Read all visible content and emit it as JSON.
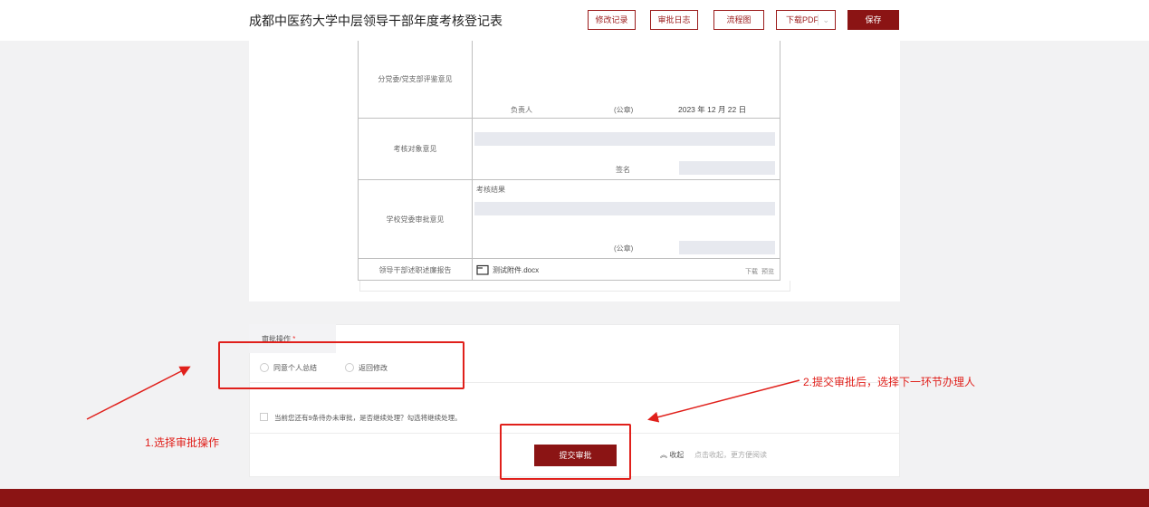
{
  "header": {
    "title": "成都中医药大学中层领导干部年度考核登记表",
    "buttons": {
      "history": "修改记录",
      "approval_log": "审批日志",
      "flowchart": "流程图",
      "download": "下载PDF",
      "save": "保存"
    }
  },
  "form": {
    "branch_opinion": {
      "label": "分党委/党支部评鉴意见",
      "responsible": "负责人",
      "seal": "(公章)",
      "date": "2023 年 12 月 22 日"
    },
    "subject_opinion": {
      "label": "考核对象意见",
      "sign": "签名"
    },
    "school_opinion": {
      "label": "学校党委审批意见",
      "result": "考核结果",
      "seal": "(公章)"
    },
    "report": {
      "label": "领导干部述职述廉报告",
      "file_name": "测试附件.docx",
      "download": "下载",
      "preview": "预览"
    }
  },
  "approval": {
    "label": "审批操作",
    "required_mark": "*",
    "options": [
      "同意个人总结",
      "返回修改"
    ],
    "continue_text": "当前您还有9条待办未审批，是否继续处理？勾选将继续处理。",
    "submit": "提交审批",
    "collapse": "收起",
    "collapse_hint": "点击收起，更方便阅读"
  },
  "annotations": {
    "step1": "1.选择审批操作",
    "step2": "2.提交审批后，选择下一环节办理人"
  },
  "colors": {
    "brand": "#8b1414",
    "annotation": "#e0201b"
  }
}
